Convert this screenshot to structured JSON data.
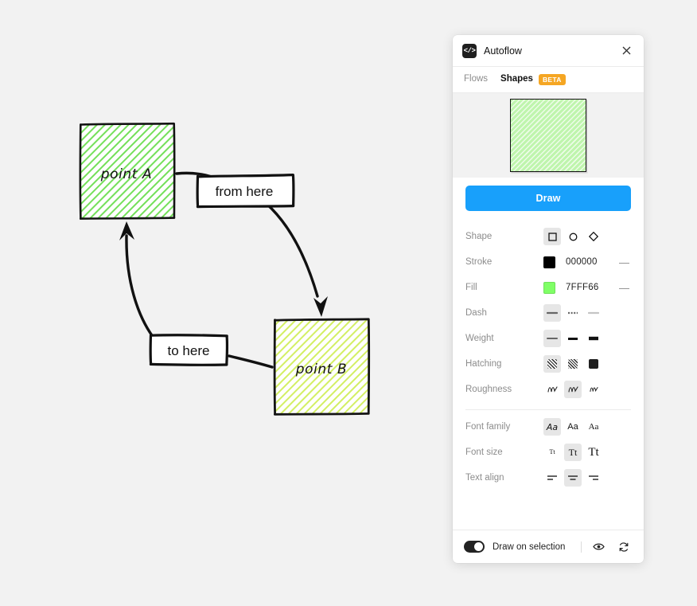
{
  "canvas": {
    "background_color": "#f2f2f2",
    "nodes": [
      {
        "id": "a",
        "label": "point A",
        "fill": "#b6f5a0",
        "stroke": "#111111"
      },
      {
        "id": "b",
        "label": "point B",
        "fill": "#e0f79a",
        "stroke": "#111111"
      }
    ],
    "edge_labels": [
      {
        "id": "from",
        "text": "from here"
      },
      {
        "id": "to",
        "text": "to here"
      }
    ]
  },
  "panel": {
    "logo_icon": "code-brackets-icon",
    "logo_glyph": "</>",
    "title": "Autoflow",
    "close_icon": "close-icon",
    "tabs": [
      {
        "label": "Flows",
        "active": false
      },
      {
        "label": "Shapes",
        "active": true,
        "badge": "BETA"
      }
    ],
    "preview": {
      "fill": "#bff5ad",
      "stroke": "#111111",
      "hatching": "diagonal"
    },
    "draw_button": "Draw",
    "properties": [
      {
        "key": "shape",
        "label": "Shape",
        "type": "icon-group",
        "selected": 0,
        "options": [
          {
            "name": "square-shape-icon"
          },
          {
            "name": "circle-shape-icon"
          },
          {
            "name": "diamond-shape-icon"
          }
        ]
      },
      {
        "key": "stroke",
        "label": "Stroke",
        "type": "color",
        "color": "#000000",
        "value": "000000",
        "remove_icon": "minus-icon"
      },
      {
        "key": "fill",
        "label": "Fill",
        "type": "color",
        "color": "#7FFF66",
        "value": "7FFF66",
        "remove_icon": "minus-icon"
      },
      {
        "key": "dash",
        "label": "Dash",
        "type": "icon-group",
        "selected": 0,
        "options": [
          {
            "name": "dash-solid-icon"
          },
          {
            "name": "dash-dotted-icon"
          },
          {
            "name": "dash-light-icon"
          }
        ]
      },
      {
        "key": "weight",
        "label": "Weight",
        "type": "icon-group",
        "selected": 0,
        "options": [
          {
            "name": "weight-thin-icon"
          },
          {
            "name": "weight-medium-icon"
          },
          {
            "name": "weight-thick-icon"
          }
        ]
      },
      {
        "key": "hatching",
        "label": "Hatching",
        "type": "icon-group",
        "selected": 0,
        "options": [
          {
            "name": "hatch-diagonal-icon"
          },
          {
            "name": "hatch-cross-icon"
          },
          {
            "name": "hatch-solid-icon"
          }
        ]
      },
      {
        "key": "roughness",
        "label": "Roughness",
        "type": "icon-group",
        "selected": 1,
        "options": [
          {
            "name": "roughness-low-icon"
          },
          {
            "name": "roughness-medium-icon"
          },
          {
            "name": "roughness-high-icon"
          }
        ]
      },
      {
        "key": "font_family",
        "label": "Font family",
        "type": "icon-group",
        "selected": 0,
        "options": [
          {
            "name": "font-handwritten-icon",
            "glyph": "Aa"
          },
          {
            "name": "font-sans-icon",
            "glyph": "Aa"
          },
          {
            "name": "font-serif-icon",
            "glyph": "Aa"
          }
        ]
      },
      {
        "key": "font_size",
        "label": "Font size",
        "type": "icon-group",
        "selected": 1,
        "options": [
          {
            "name": "font-size-small-icon",
            "glyph": "Tt"
          },
          {
            "name": "font-size-medium-icon",
            "glyph": "Tt"
          },
          {
            "name": "font-size-large-icon",
            "glyph": "Tt"
          }
        ]
      },
      {
        "key": "text_align",
        "label": "Text align",
        "type": "icon-group",
        "selected": 1,
        "options": [
          {
            "name": "align-left-icon"
          },
          {
            "name": "align-center-icon"
          },
          {
            "name": "align-right-icon"
          }
        ]
      }
    ],
    "footer": {
      "toggle_on": true,
      "toggle_label": "Draw on selection",
      "preview_icon": "eye-icon",
      "refresh_icon": "refresh-icon"
    },
    "accent_color": "#18a0fb",
    "badge_color": "#f5a623"
  }
}
